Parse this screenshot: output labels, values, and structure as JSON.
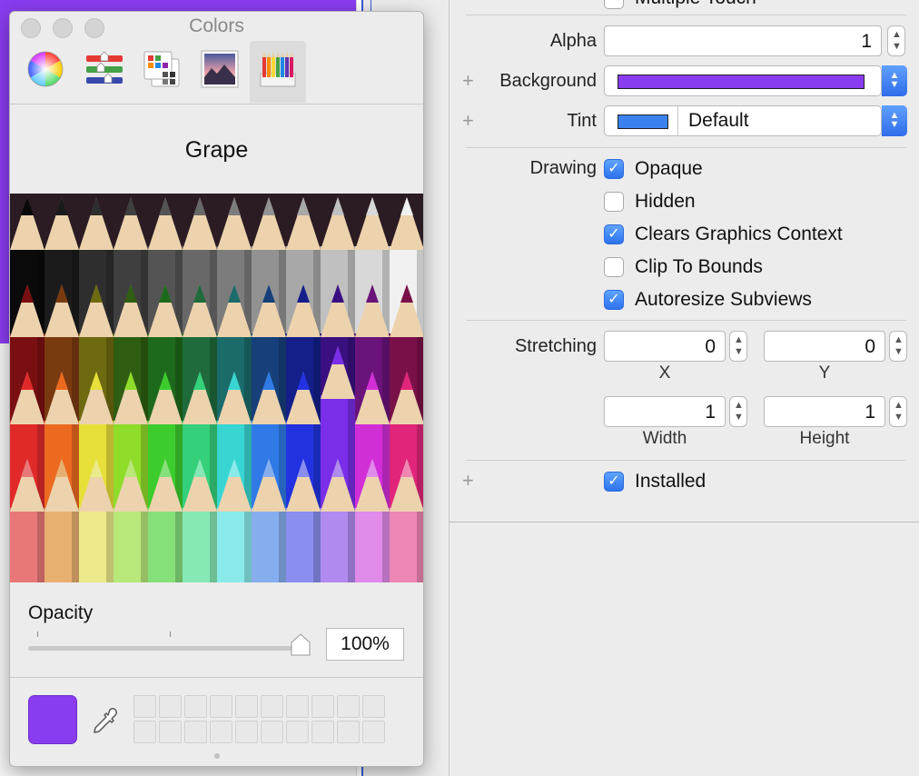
{
  "colors_panel": {
    "title": "Colors",
    "toolbar": [
      {
        "icon": "color-wheel-icon"
      },
      {
        "icon": "color-sliders-icon"
      },
      {
        "icon": "color-palettes-icon"
      },
      {
        "icon": "image-palettes-icon"
      },
      {
        "icon": "pencils-icon",
        "selected": true
      }
    ],
    "selected_color_name": "Grape",
    "opacity_label": "Opacity",
    "opacity_value": "100%",
    "opacity_fraction": 1.0,
    "current_color": "#8a3cf0",
    "swatch_count": 20
  },
  "canvas": {
    "view_background_color": "#8a3cf0"
  },
  "inspector": {
    "partial_top_label": "Multiple Touch",
    "alpha": {
      "label": "Alpha",
      "value": "1"
    },
    "background": {
      "label": "Background",
      "color": "#8a3cf0"
    },
    "tint": {
      "label": "Tint",
      "value": "Default",
      "color": "#3b82f0"
    },
    "drawing": {
      "label": "Drawing",
      "options": [
        {
          "label": "Opaque",
          "checked": true
        },
        {
          "label": "Hidden",
          "checked": false
        },
        {
          "label": "Clears Graphics Context",
          "checked": true
        },
        {
          "label": "Clip To Bounds",
          "checked": false
        },
        {
          "label": "Autoresize Subviews",
          "checked": true
        }
      ]
    },
    "stretching": {
      "label": "Stretching",
      "x": {
        "value": "0",
        "label": "X"
      },
      "y": {
        "value": "0",
        "label": "Y"
      },
      "width": {
        "value": "1",
        "label": "Width"
      },
      "height": {
        "value": "1",
        "label": "Height"
      }
    },
    "installed": {
      "label": "Installed",
      "checked": true
    }
  }
}
